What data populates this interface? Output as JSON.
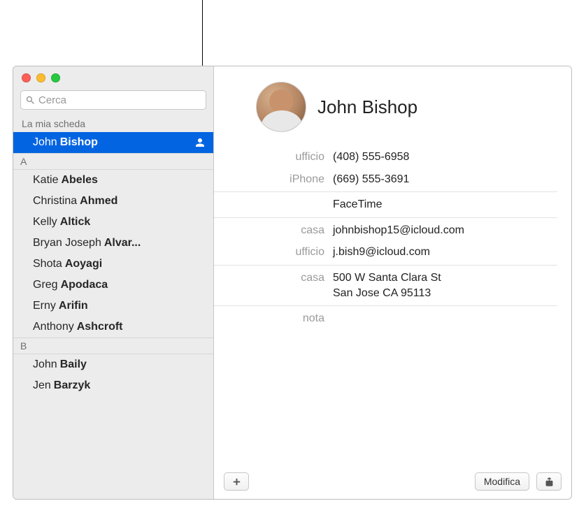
{
  "search": {
    "placeholder": "Cerca"
  },
  "sidebar": {
    "my_card_label": "La mia scheda",
    "my_card_name_first": "John",
    "my_card_name_last": "Bishop",
    "sections": [
      {
        "letter": "A",
        "contacts": [
          {
            "first": "Katie",
            "last": "Abeles"
          },
          {
            "first": "Christina",
            "last": "Ahmed"
          },
          {
            "first": "Kelly",
            "last": "Altick"
          },
          {
            "first": "Bryan Joseph",
            "last": "Alvar..."
          },
          {
            "first": "Shota",
            "last": "Aoyagi"
          },
          {
            "first": "Greg",
            "last": "Apodaca"
          },
          {
            "first": "Erny",
            "last": "Arifin"
          },
          {
            "first": "Anthony",
            "last": "Ashcroft"
          }
        ]
      },
      {
        "letter": "B",
        "contacts": [
          {
            "first": "John",
            "last": "Baily"
          },
          {
            "first": "Jen",
            "last": "Barzyk"
          }
        ]
      }
    ]
  },
  "detail": {
    "name": "John Bishop",
    "phones": [
      {
        "label": "ufficio",
        "value": "(408) 555-6958"
      },
      {
        "label": "iPhone",
        "value": "(669) 555-3691"
      }
    ],
    "facetime": {
      "label": "",
      "value": "FaceTime"
    },
    "emails": [
      {
        "label": "casa",
        "value": "johnbishop15@icloud.com"
      },
      {
        "label": "ufficio",
        "value": "j.bish9@icloud.com"
      }
    ],
    "address": {
      "label": "casa",
      "value": "500 W Santa Clara St\nSan Jose CA 95113"
    },
    "note_label": "nota"
  },
  "footer": {
    "edit_label": "Modifica"
  }
}
